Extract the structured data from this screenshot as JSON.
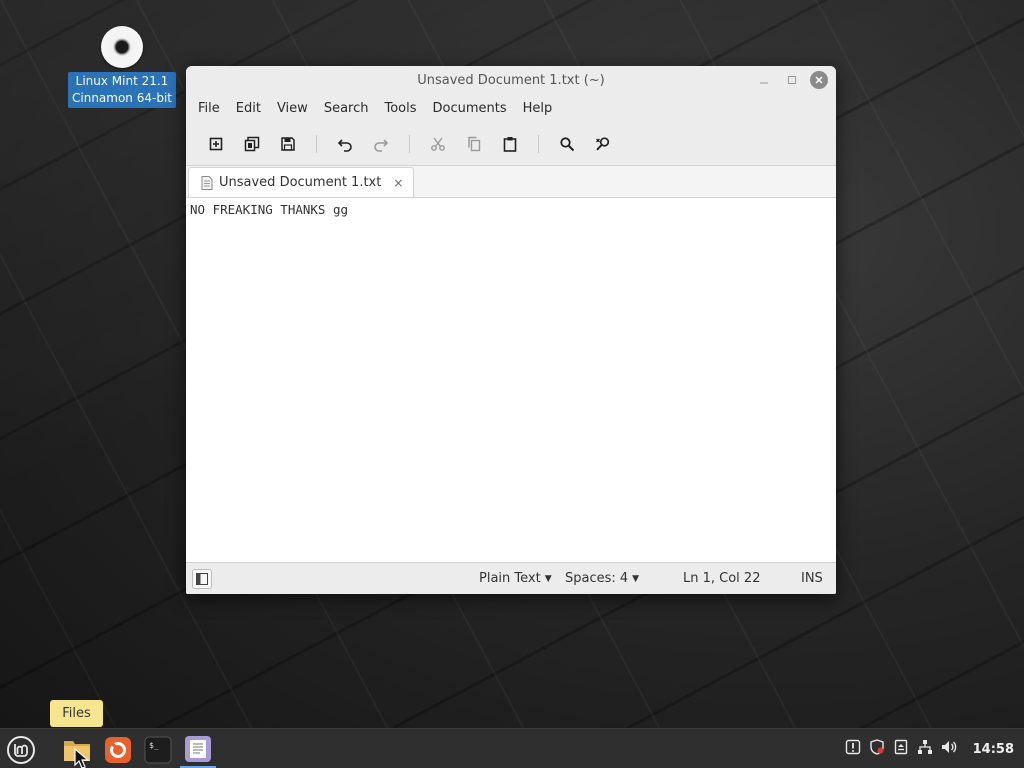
{
  "desktop": {
    "icon_label_line1": "Linux Mint 21.1",
    "icon_label_line2": "Cinnamon 64-bit"
  },
  "window": {
    "title": "Unsaved Document 1.txt (~)",
    "menu": [
      "File",
      "Edit",
      "View",
      "Search",
      "Tools",
      "Documents",
      "Help"
    ],
    "toolbar_icons": [
      "new-document-icon",
      "open-document-icon",
      "save-icon",
      "undo-icon",
      "redo-icon",
      "cut-icon",
      "copy-icon",
      "paste-icon",
      "find-icon",
      "find-replace-icon"
    ],
    "tab": {
      "label": "Unsaved Document 1.txt",
      "close": "×"
    },
    "editor_text": "NO FREAKING THANKS gg",
    "status": {
      "language": "Plain Text",
      "spaces": "Spaces: 4",
      "position": "Ln 1, Col 22",
      "mode": "INS"
    }
  },
  "tooltip": {
    "text": "Files"
  },
  "taskbar": {
    "apps": [
      "mint-menu-icon",
      "files-icon",
      "firefox-icon",
      "terminal-icon",
      "text-editor-icon"
    ],
    "tray_icons": [
      "update-manager-icon",
      "shield-icon",
      "removable-drive-icon",
      "network-icon",
      "volume-icon"
    ],
    "clock": "14:58"
  },
  "colors": {
    "accent": "#2a73b8",
    "tooltip_bg": "#f6e58f",
    "panel_bg": "#2f2f2f"
  }
}
